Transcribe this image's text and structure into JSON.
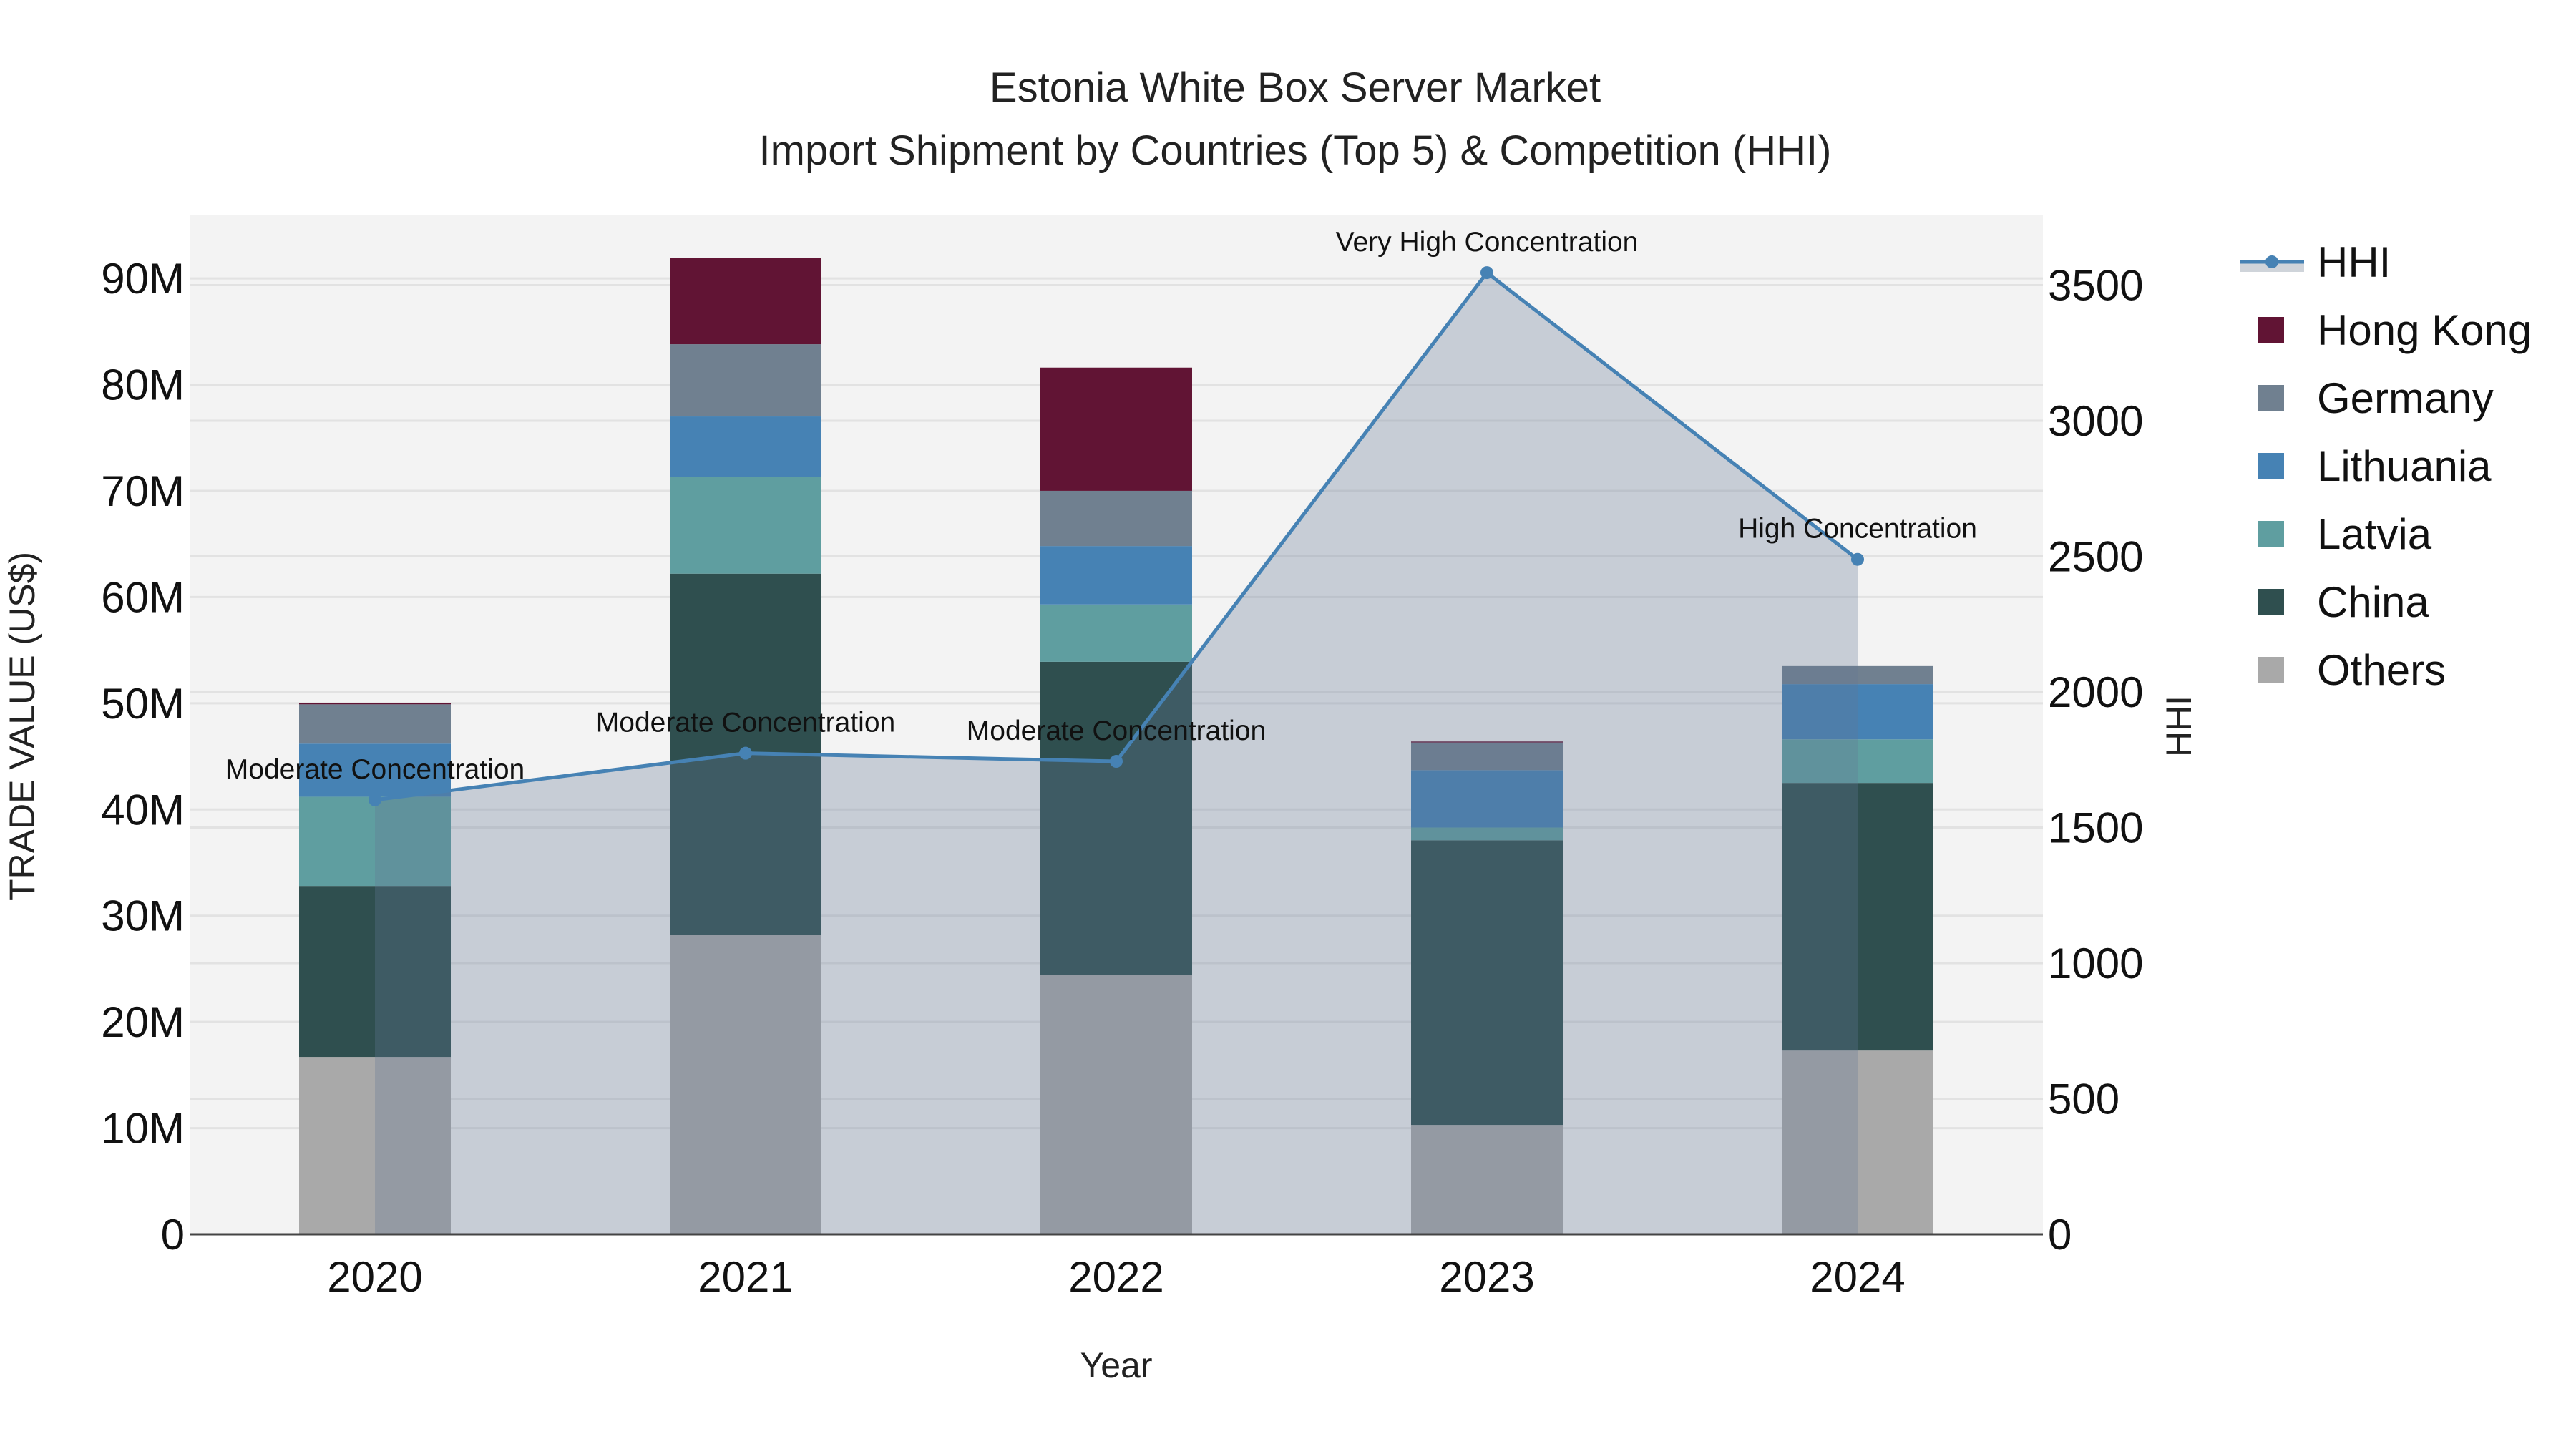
{
  "chart_data": {
    "type": "bar",
    "stacked": true,
    "title": "Estonia White Box Server Market",
    "subtitle": "Import Shipment by Countries (Top 5) & Competition (HHI)",
    "xlabel": "Year",
    "ylabel": "TRADE VALUE (US$)",
    "y2label": "HHI",
    "categories": [
      "2020",
      "2021",
      "2022",
      "2023",
      "2024"
    ],
    "ylim": [
      0,
      96
    ],
    "y_ticks": [
      0,
      10,
      20,
      30,
      40,
      50,
      60,
      70,
      80,
      90
    ],
    "y_tick_labels": [
      "0",
      "10M",
      "20M",
      "30M",
      "40M",
      "50M",
      "60M",
      "70M",
      "80M",
      "90M"
    ],
    "y2lim": [
      0,
      3760
    ],
    "y2_ticks": [
      0,
      500,
      1000,
      1500,
      2000,
      2500,
      3000,
      3500
    ],
    "y2_tick_labels": [
      "0",
      "500",
      "1000",
      "1500",
      "2000",
      "2500",
      "3000",
      "3500"
    ],
    "value_unit": "million US$",
    "series": [
      {
        "name": "Others",
        "color": "#a9a9a9",
        "values": [
          16.7,
          28.2,
          24.4,
          10.3,
          17.3
        ]
      },
      {
        "name": "China",
        "color": "#2f4f4f",
        "values": [
          16.1,
          34.0,
          29.5,
          26.8,
          25.2
        ]
      },
      {
        "name": "Latvia",
        "color": "#5f9ea0",
        "values": [
          8.4,
          9.1,
          5.4,
          1.2,
          4.1
        ]
      },
      {
        "name": "Lithuania",
        "color": "#4682b4",
        "values": [
          5.0,
          5.7,
          5.5,
          5.4,
          5.2
        ]
      },
      {
        "name": "Germany",
        "color": "#708090",
        "values": [
          3.7,
          6.8,
          5.2,
          2.6,
          1.7
        ]
      },
      {
        "name": "Hong Kong",
        "color": "#611434",
        "values": [
          0.1,
          8.1,
          11.6,
          0.1,
          0.0
        ]
      }
    ],
    "line_series": {
      "name": "HHI",
      "axis": "right",
      "color": "#4682b4",
      "values": [
        1602,
        1774,
        1744,
        3546,
        2489
      ],
      "annotations": [
        "Moderate Concentration",
        "Moderate Concentration",
        "Moderate Concentration",
        "Very High Concentration",
        "High Concentration"
      ]
    },
    "legend": {
      "placement": "right",
      "order": [
        "HHI",
        "Hong Kong",
        "Germany",
        "Lithuania",
        "Latvia",
        "China",
        "Others"
      ]
    },
    "grid": true
  }
}
